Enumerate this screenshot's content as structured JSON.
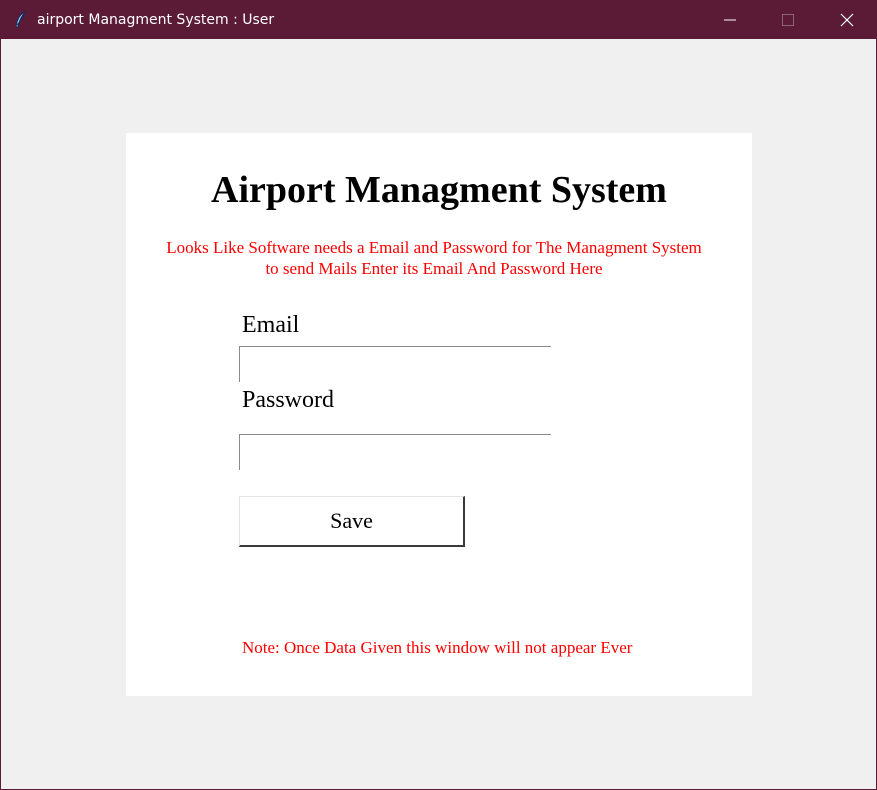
{
  "window": {
    "title": "airport Managment System : User",
    "app_icon": "feather-icon",
    "controls": {
      "minimize_icon": "minimize-icon",
      "maximize_icon": "maximize-icon",
      "close_icon": "close-icon"
    },
    "titlebar_color": "#5b1a36"
  },
  "form": {
    "heading": "Airport Managment System",
    "notice_line1": "Looks Like Software needs a Email and Password for The Managment System",
    "notice_line2": "to send Mails Enter its Email And Password Here",
    "email_label": "Email",
    "email_value": "",
    "password_label": "Password",
    "password_value": "",
    "save_label": "Save",
    "footnote": "Note: Once Data Given this window will not appear Ever",
    "accent_color": "#ff0000"
  }
}
